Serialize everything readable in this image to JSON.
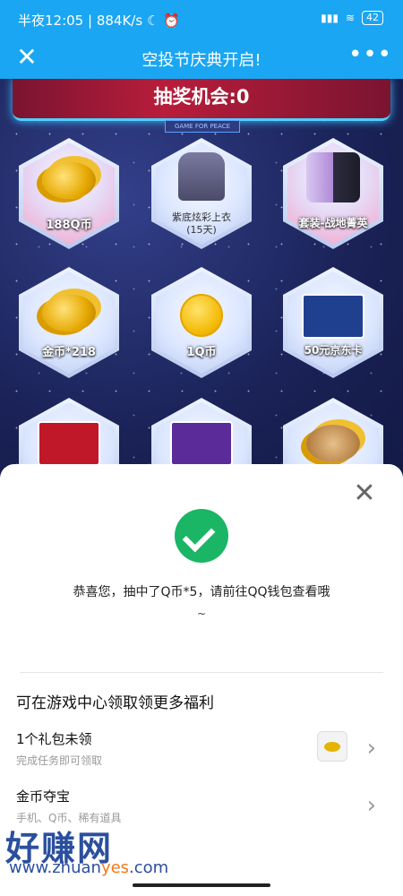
{
  "status_bar": {
    "time": "半夜12:05",
    "speed": "884K/s",
    "battery": "42"
  },
  "titlebar": {
    "title": "空投节庆典开启!"
  },
  "banner": {
    "chance_text": "抽奖机会:0",
    "tag": "GAME FOR PEACE"
  },
  "prizes": [
    {
      "label": "188Q币"
    },
    {
      "label": "紫底炫彩上衣",
      "sub": "(15天)"
    },
    {
      "label": "套装-战地菁英"
    },
    {
      "label": "金币*218"
    },
    {
      "label": "1Q币"
    },
    {
      "label": "50元京东卡"
    }
  ],
  "modal": {
    "message": "恭喜您，抽中了Q币*5，请前往QQ钱包查看哦",
    "tilde": "~",
    "section_title": "可在游戏中心领取领更多福利",
    "rows": [
      {
        "title": "1个礼包未领",
        "subtitle": "完成任务即可领取"
      },
      {
        "title": "金币夺宝",
        "subtitle": "手机、Q币、稀有道具"
      }
    ]
  },
  "watermark": {
    "text": "好赚网",
    "url_prefix": "www.zhuan",
    "url_highlight": "yes",
    "url_suffix": ".com"
  },
  "colors": {
    "primary": "#1aa6f2",
    "success": "#1bb566"
  }
}
